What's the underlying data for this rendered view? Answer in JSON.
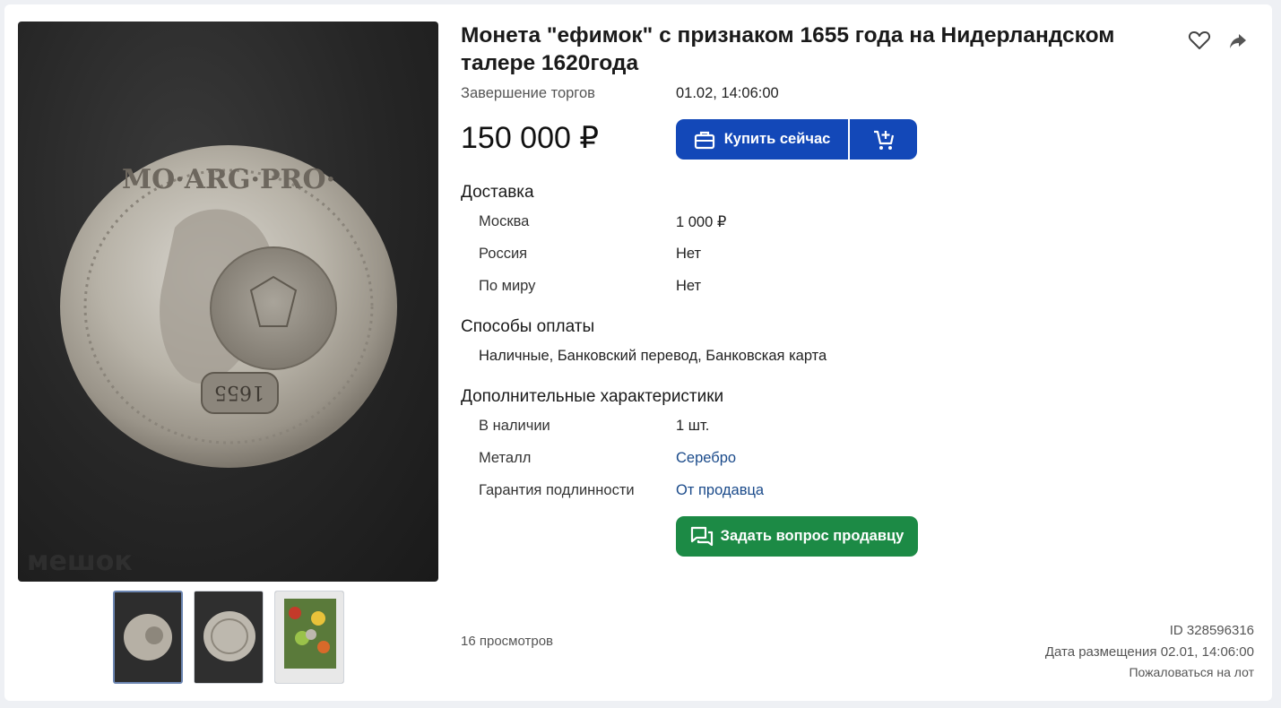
{
  "lot": {
    "title": "Монета \"ефимок\" с признаком 1655 года на Нидерландском талере 1620года",
    "end_label": "Завершение торгов",
    "end_value": "01.02, 14:06:00",
    "price": "150 000 ₽",
    "buy_now_label": "Купить сейчас"
  },
  "watermark": "мешок",
  "coin_legend_top": "MO·ARG·PRO·",
  "coin_countermark": "1655",
  "delivery": {
    "heading": "Доставка",
    "rows": [
      {
        "label": "Москва",
        "value": "1 000 ₽"
      },
      {
        "label": "Россия",
        "value": "Нет"
      },
      {
        "label": "По миру",
        "value": "Нет"
      }
    ]
  },
  "payment": {
    "heading": "Способы оплаты",
    "methods": "Наличные, Банковский перевод, Банковская карта"
  },
  "extra": {
    "heading": "Дополнительные характеристики",
    "rows": [
      {
        "label": "В наличии",
        "value": "1 шт."
      },
      {
        "label": "Металл",
        "value": "Серебро"
      },
      {
        "label": "Гарантия подлинности",
        "value": "От продавца"
      }
    ]
  },
  "ask_seller_label": "Задать вопрос продавцу",
  "footer": {
    "views": "16 просмотров",
    "id": "ID 328596316",
    "posted": "Дата размещения 02.01, 14:06:00",
    "report": "Пожаловаться на лот"
  },
  "icons": {
    "favorite": "heart-outline-icon",
    "share": "share-arrow-icon",
    "buy": "briefcase-icon",
    "cart": "cart-plus-icon",
    "ask": "chat-icon"
  },
  "colors": {
    "primary_button": "#1348b8",
    "ask_button": "#1c8a45",
    "link": "#1a4a8a"
  }
}
